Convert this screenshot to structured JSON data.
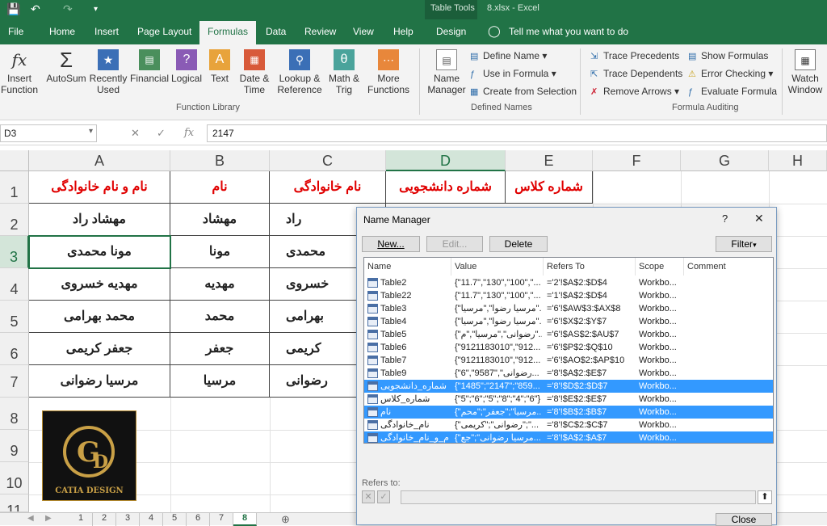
{
  "app": {
    "table_tools": "Table Tools",
    "title": "8.xlsx  -  Excel"
  },
  "tabs": [
    "File",
    "Home",
    "Insert",
    "Page Layout",
    "Formulas",
    "Data",
    "Review",
    "View",
    "Help",
    "Design"
  ],
  "tell_me": "Tell me what you want to do",
  "ribbon": {
    "insert_function": "Insert\nFunction",
    "autosum": "AutoSum",
    "recently_used": "Recently\nUsed",
    "financial": "Financial",
    "logical": "Logical",
    "text": "Text",
    "date_time": "Date &\nTime",
    "lookup": "Lookup &\nReference",
    "math": "Math &\nTrig",
    "more": "More\nFunctions",
    "function_library": "Function Library",
    "name_manager": "Name\nManager",
    "define_name": "Define Name",
    "use_in_formula": "Use in Formula",
    "create_from_selection": "Create from Selection",
    "defined_names": "Defined Names",
    "trace_precedents": "Trace Precedents",
    "trace_dependents": "Trace Dependents",
    "remove_arrows": "Remove Arrows",
    "show_formulas": "Show Formulas",
    "error_checking": "Error Checking",
    "evaluate_formula": "Evaluate Formula",
    "formula_auditing": "Formula Auditing",
    "watch_window": "Watch\nWindow"
  },
  "formula_bar": {
    "name_box": "D3",
    "value": "2147"
  },
  "columns": [
    "A",
    "B",
    "C",
    "D",
    "E",
    "F",
    "G",
    "H"
  ],
  "rows": [
    "1",
    "2",
    "3",
    "4",
    "5",
    "6",
    "7",
    "8",
    "9",
    "10",
    "11"
  ],
  "sheet": {
    "headers": [
      "نام و نام خانوادگی",
      "نام",
      "نام خانوادگی",
      "شماره دانشجویی",
      "شماره کلاس"
    ],
    "data": [
      [
        "مهشاد راد",
        "مهشاد",
        "راد"
      ],
      [
        "مونا محمدی",
        "مونا",
        "محمدی"
      ],
      [
        "مهدیه خسروی",
        "مهدیه",
        "خسروی"
      ],
      [
        "محمد بهرامی",
        "محمد",
        "بهرامی"
      ],
      [
        "جعفر کریمی",
        "جعفر",
        "کریمی"
      ],
      [
        "مرسیا رضوانی",
        "مرسیا",
        "رضوانی"
      ]
    ]
  },
  "logo_text": "CATIA DESIGN",
  "sheet_tabs": [
    "1",
    "2",
    "3",
    "4",
    "5",
    "6",
    "7",
    "8"
  ],
  "dialog": {
    "title": "Name Manager",
    "help": "?",
    "close_x": "✕",
    "new": "New...",
    "edit": "Edit...",
    "delete": "Delete",
    "filter": "Filter",
    "columns": [
      "Name",
      "Value",
      "Refers To",
      "Scope",
      "Comment"
    ],
    "rows": [
      {
        "name": "Table2",
        "value": "{\"11.7\",\"130\",\"100\",\"...",
        "refers": "='2'!$A$2:$D$4",
        "scope": "Workbo...",
        "selected": false
      },
      {
        "name": "Table22",
        "value": "{\"11.7\",\"130\",\"100\",\"...",
        "refers": "='1'!$A$2:$D$4",
        "scope": "Workbo...",
        "selected": false
      },
      {
        "name": "Table3",
        "value": "{\"مرسیا رضوا\",\"مرسیا\"...",
        "refers": "='6'!$AW$3:$AX$8",
        "scope": "Workbo...",
        "selected": false
      },
      {
        "name": "Table4",
        "value": "{\"مرسیا رضوا\",\"مرسیا\"...",
        "refers": "='6'!$X$2:$Y$7",
        "scope": "Workbo...",
        "selected": false
      },
      {
        "name": "Table5",
        "value": "{\"رضوانی\",\"مرسیا\",\"م\"...",
        "refers": "='6'!$AS$2:$AU$7",
        "scope": "Workbo...",
        "selected": false
      },
      {
        "name": "Table6",
        "value": "{\"9121183010\",\"912...",
        "refers": "='6'!$P$2:$Q$10",
        "scope": "Workbo...",
        "selected": false
      },
      {
        "name": "Table7",
        "value": "{\"9121183010\",\"912...",
        "refers": "='6'!$AO$2:$AP$10",
        "scope": "Workbo...",
        "selected": false
      },
      {
        "name": "Table9",
        "value": "{\"6\",\"9587\",\"رضوانی...",
        "refers": "='8'!$A$2:$E$7",
        "scope": "Workbo...",
        "selected": false
      },
      {
        "name": "شماره_دانشجویی",
        "value": "{\"1485\";\"2147\";\"859...",
        "refers": "='8'!$D$2:$D$7",
        "scope": "Workbo...",
        "selected": true
      },
      {
        "name": "شماره_کلاس",
        "value": "{\"5\";\"6\";\"5\";\"8\";\"4\";\"6\"}",
        "refers": "='8'!$E$2:$E$7",
        "scope": "Workbo...",
        "selected": false
      },
      {
        "name": "نام",
        "value": "{\"مرسیا\";\"جعفر\";\"محم...",
        "refers": "='8'!$B$2:$B$7",
        "scope": "Workbo...",
        "selected": true
      },
      {
        "name": "نام_خانوادگی",
        "value": "{\"رضوانی\";\"کریمی\";\"...",
        "refers": "='8'!$C$2:$C$7",
        "scope": "Workbo...",
        "selected": false
      },
      {
        "name": "نام_و_نام_خانوادگی",
        "value": "{\"مرسیا رضوانی\";\"جع...",
        "refers": "='8'!$A$2:$A$7",
        "scope": "Workbo...",
        "selected": true
      }
    ],
    "refers_to_label": "Refers to:",
    "close": "Close"
  }
}
